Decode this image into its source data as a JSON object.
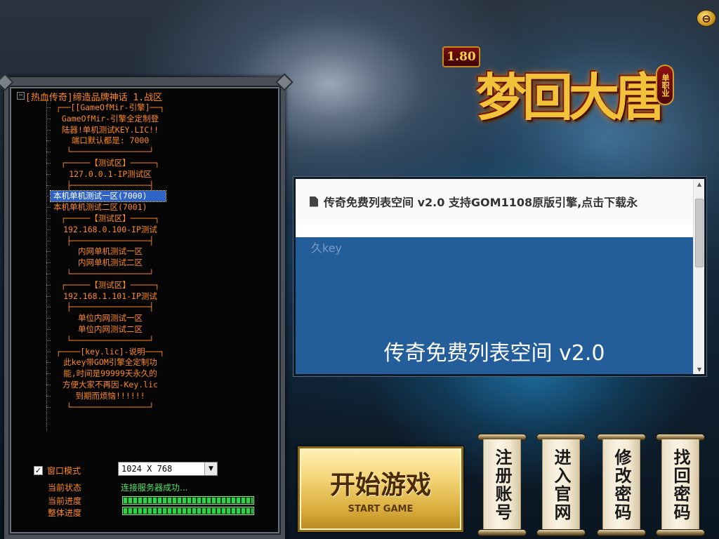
{
  "window": {
    "close_glyph": "⊖"
  },
  "logo": {
    "version": "1.80",
    "title": "梦回大唐",
    "badge": "单职业"
  },
  "server_tree": {
    "root_label": "[热血传奇]缔造品牌神话 1.战区",
    "expander": "−",
    "items": [
      "┌──[[GameOfMir-引擎]──┐",
      "GameOfMir-引擎全定制登",
      "陆器!单机测试KEY.LIC!!",
      "端口默认都是: 7000",
      "└────────────────┘",
      "┌─────【测试区】─────┐",
      "127.0.0.1-IP测试区",
      "├────────────────┤",
      "本机单机测试一区(7000)",
      "本机单机测试二区(7001)",
      "┌─────【测试区】─────┐",
      "192.168.0.100-IP测试",
      "├────────────────┤",
      "内网单机测试一区",
      "内网单机测试二区",
      "└────────────────┘",
      "┌─────【测试区】─────┐",
      "192.168.1.101-IP测试",
      "├────────────────┤",
      "单位内网测试一区",
      "单位内网测试二区",
      "└────────────────┘",
      "┌────[key.lic]-说明───┐",
      "此key带GOM引擎全定制功",
      "能,时间是99999天永久的",
      "方便大家不再因-Key.lic",
      "到期而烦恼!!!!!!",
      "└────────────────┘"
    ],
    "selected_label": "本机单机测试一区(7000)"
  },
  "controls": {
    "window_mode_label": "窗口模式",
    "window_mode_checked": "✓",
    "resolution_value": "1024 X 768",
    "dropdown_glyph": "▼",
    "status_label": "当前状态",
    "status_value": "连接服务器成功...",
    "current_progress_label": "当前进度",
    "total_progress_label": "整体进度",
    "current_progress": 1.0,
    "total_progress": 1.0
  },
  "news": {
    "header": "传奇免费列表空间 v2.0 支持GOM1108原版引擎,点击下载永",
    "key_text": "久key",
    "big_title": "传奇免费列表空间 v2.0",
    "scroll_up": "▲",
    "scroll_down": "▼"
  },
  "buttons": {
    "start_main": "开始游戏",
    "start_sub": "START GAME",
    "register": "注册账号",
    "website": "进入官网",
    "change_password": "修改密码",
    "recover_password": "找回密码"
  },
  "colors": {
    "accent_orange": "#ff8a1e",
    "status_green": "#4ee36a",
    "selection_blue": "#2f63c6",
    "news_blue": "#245e9a"
  }
}
